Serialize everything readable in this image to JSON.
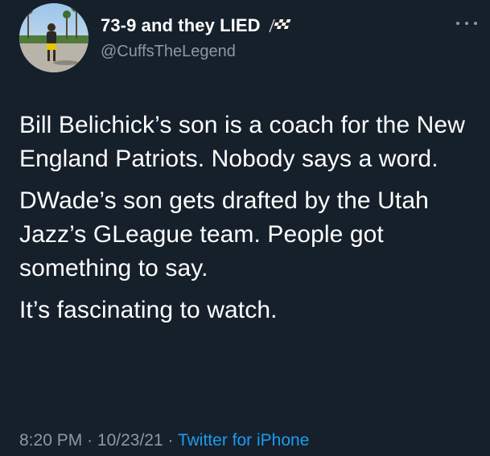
{
  "colors": {
    "background": "#15202b",
    "text_primary": "#ffffff",
    "text_secondary": "#8b98a5",
    "link": "#1d9bf0"
  },
  "author": {
    "display_name": "73-9 and they LIED",
    "name_emoji": "checkered-flag-icon",
    "handle": "@CuffsTheLegend",
    "avatar": "profile-avatar"
  },
  "more_menu": {
    "icon": "more-horizontal-icon"
  },
  "tweet": {
    "paragraphs": [
      "Bill Belichick’s son is a coach for the New England Patriots. Nobody says a word.",
      "DWade’s son gets drafted by the Utah Jazz’s GLeague team. People got something to say.",
      "It’s fascinating to watch."
    ],
    "time": "8:20 PM",
    "date": "10/23/21",
    "separator": "·",
    "source": "Twitter for iPhone"
  }
}
